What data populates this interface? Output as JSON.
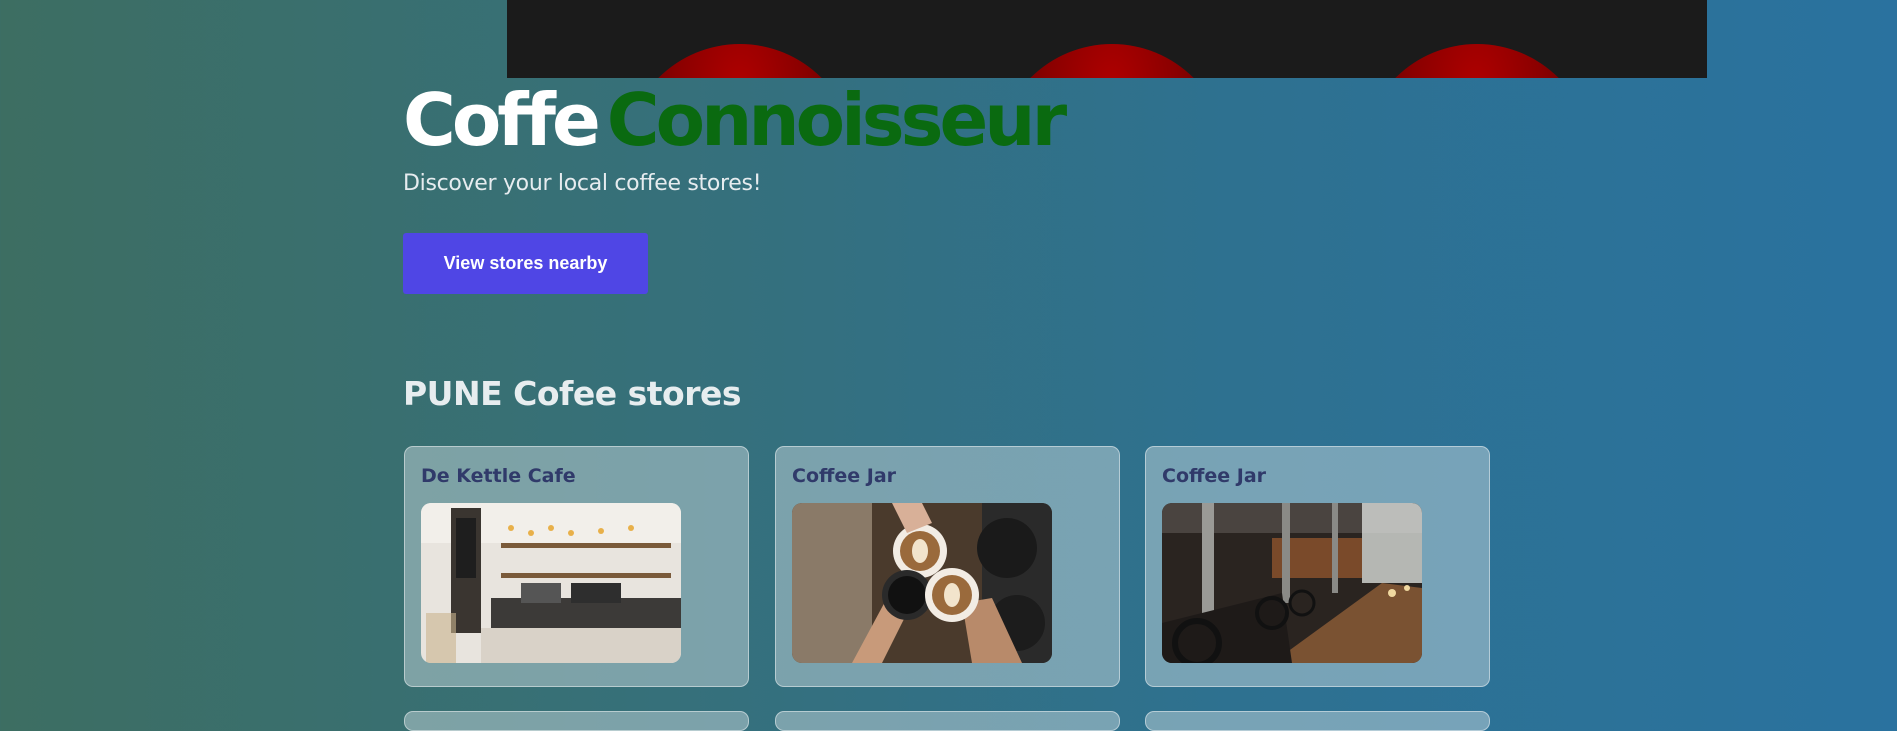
{
  "hero": {
    "title_part1": "Coffe",
    "title_part2": "Connoisseur",
    "subtitle": "Discover your local coffee stores!",
    "cta_label": "View stores nearby"
  },
  "section": {
    "heading": "PUNE Cofee stores"
  },
  "stores": [
    {
      "name": "De Kettle Cafe"
    },
    {
      "name": "Coffee Jar"
    },
    {
      "name": "Coffee Jar"
    }
  ],
  "colors": {
    "brand_accent": "#4f46e5",
    "title_green": "#0a6a10",
    "card_title": "#303a6a"
  }
}
